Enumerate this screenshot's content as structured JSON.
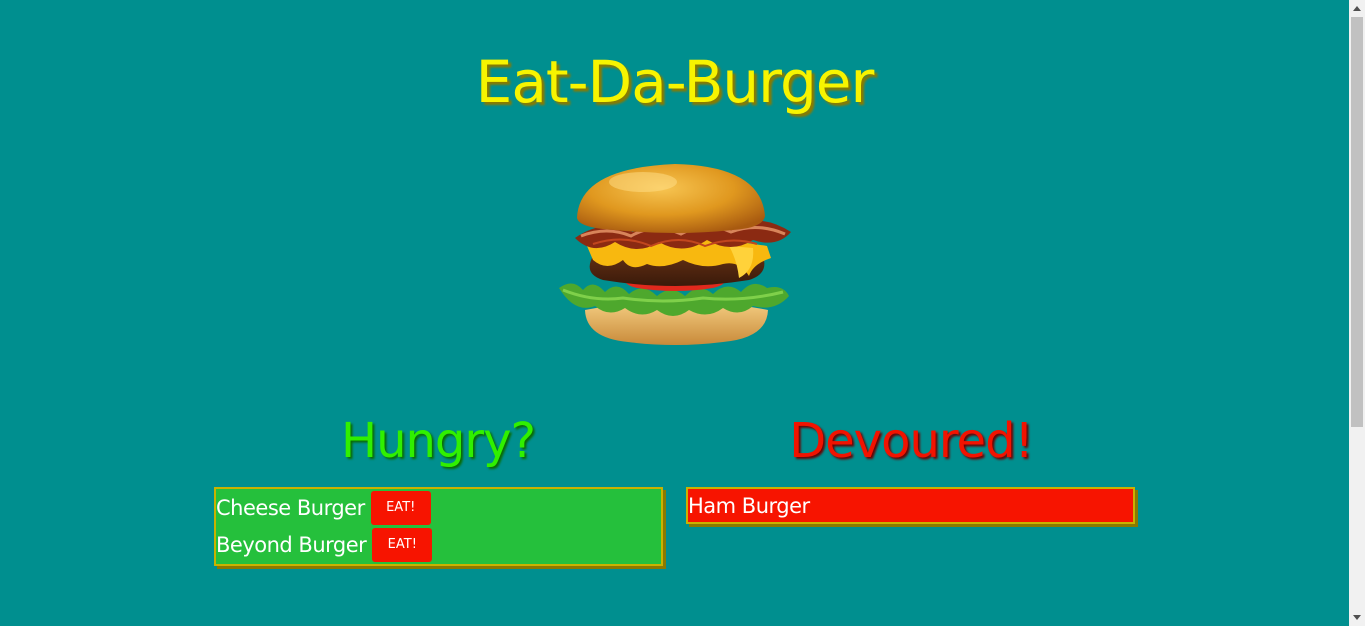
{
  "header": {
    "title": "Eat-Da-Burger",
    "image_icon": "burger-image"
  },
  "hungry": {
    "heading": "Hungry?",
    "items": [
      {
        "name": "Cheese Burger",
        "button_label": "EAT!"
      },
      {
        "name": "Beyond Burger",
        "button_label": "EAT!"
      }
    ]
  },
  "devoured": {
    "heading": "Devoured!",
    "items": [
      {
        "name": "Ham Burger"
      }
    ]
  },
  "colors": {
    "background": "#008f8f",
    "title": "#f7f400",
    "hungry_heading": "#30f000",
    "devoured_heading": "#f21300",
    "hungry_box": "#25c03c",
    "devoured_box": "#f71400",
    "button": "#f71400"
  }
}
